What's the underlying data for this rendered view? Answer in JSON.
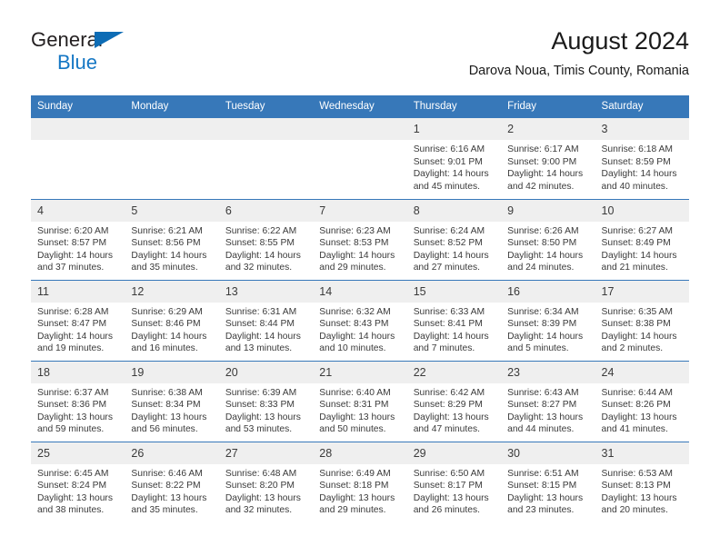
{
  "brand": {
    "name_top": "General",
    "name_bottom": "Blue",
    "triangle_color": "#0d6cb5",
    "text_color": "#231f20",
    "blue_color": "#1577c4"
  },
  "header": {
    "title": "August 2024",
    "subtitle": "Darova Noua, Timis County, Romania"
  },
  "theme": {
    "header_blue": "#3778b9",
    "daynum_band": "#efefef",
    "text": "#3a3a3a",
    "page_bg": "#ffffff"
  },
  "weekdays": [
    "Sunday",
    "Monday",
    "Tuesday",
    "Wednesday",
    "Thursday",
    "Friday",
    "Saturday"
  ],
  "calendar_data": {
    "month": "August",
    "year": 2024,
    "location": "Darova Noua, Timis County, Romania",
    "first_day_of_week": "Sunday",
    "weeks": [
      [
        {
          "day": "",
          "lines": []
        },
        {
          "day": "",
          "lines": []
        },
        {
          "day": "",
          "lines": []
        },
        {
          "day": "",
          "lines": []
        },
        {
          "day": "1",
          "lines": [
            "Sunrise: 6:16 AM",
            "Sunset: 9:01 PM",
            "Daylight: 14 hours and 45 minutes."
          ]
        },
        {
          "day": "2",
          "lines": [
            "Sunrise: 6:17 AM",
            "Sunset: 9:00 PM",
            "Daylight: 14 hours and 42 minutes."
          ]
        },
        {
          "day": "3",
          "lines": [
            "Sunrise: 6:18 AM",
            "Sunset: 8:59 PM",
            "Daylight: 14 hours and 40 minutes."
          ]
        }
      ],
      [
        {
          "day": "4",
          "lines": [
            "Sunrise: 6:20 AM",
            "Sunset: 8:57 PM",
            "Daylight: 14 hours and 37 minutes."
          ]
        },
        {
          "day": "5",
          "lines": [
            "Sunrise: 6:21 AM",
            "Sunset: 8:56 PM",
            "Daylight: 14 hours and 35 minutes."
          ]
        },
        {
          "day": "6",
          "lines": [
            "Sunrise: 6:22 AM",
            "Sunset: 8:55 PM",
            "Daylight: 14 hours and 32 minutes."
          ]
        },
        {
          "day": "7",
          "lines": [
            "Sunrise: 6:23 AM",
            "Sunset: 8:53 PM",
            "Daylight: 14 hours and 29 minutes."
          ]
        },
        {
          "day": "8",
          "lines": [
            "Sunrise: 6:24 AM",
            "Sunset: 8:52 PM",
            "Daylight: 14 hours and 27 minutes."
          ]
        },
        {
          "day": "9",
          "lines": [
            "Sunrise: 6:26 AM",
            "Sunset: 8:50 PM",
            "Daylight: 14 hours and 24 minutes."
          ]
        },
        {
          "day": "10",
          "lines": [
            "Sunrise: 6:27 AM",
            "Sunset: 8:49 PM",
            "Daylight: 14 hours and 21 minutes."
          ]
        }
      ],
      [
        {
          "day": "11",
          "lines": [
            "Sunrise: 6:28 AM",
            "Sunset: 8:47 PM",
            "Daylight: 14 hours and 19 minutes."
          ]
        },
        {
          "day": "12",
          "lines": [
            "Sunrise: 6:29 AM",
            "Sunset: 8:46 PM",
            "Daylight: 14 hours and 16 minutes."
          ]
        },
        {
          "day": "13",
          "lines": [
            "Sunrise: 6:31 AM",
            "Sunset: 8:44 PM",
            "Daylight: 14 hours and 13 minutes."
          ]
        },
        {
          "day": "14",
          "lines": [
            "Sunrise: 6:32 AM",
            "Sunset: 8:43 PM",
            "Daylight: 14 hours and 10 minutes."
          ]
        },
        {
          "day": "15",
          "lines": [
            "Sunrise: 6:33 AM",
            "Sunset: 8:41 PM",
            "Daylight: 14 hours and 7 minutes."
          ]
        },
        {
          "day": "16",
          "lines": [
            "Sunrise: 6:34 AM",
            "Sunset: 8:39 PM",
            "Daylight: 14 hours and 5 minutes."
          ]
        },
        {
          "day": "17",
          "lines": [
            "Sunrise: 6:35 AM",
            "Sunset: 8:38 PM",
            "Daylight: 14 hours and 2 minutes."
          ]
        }
      ],
      [
        {
          "day": "18",
          "lines": [
            "Sunrise: 6:37 AM",
            "Sunset: 8:36 PM",
            "Daylight: 13 hours and 59 minutes."
          ]
        },
        {
          "day": "19",
          "lines": [
            "Sunrise: 6:38 AM",
            "Sunset: 8:34 PM",
            "Daylight: 13 hours and 56 minutes."
          ]
        },
        {
          "day": "20",
          "lines": [
            "Sunrise: 6:39 AM",
            "Sunset: 8:33 PM",
            "Daylight: 13 hours and 53 minutes."
          ]
        },
        {
          "day": "21",
          "lines": [
            "Sunrise: 6:40 AM",
            "Sunset: 8:31 PM",
            "Daylight: 13 hours and 50 minutes."
          ]
        },
        {
          "day": "22",
          "lines": [
            "Sunrise: 6:42 AM",
            "Sunset: 8:29 PM",
            "Daylight: 13 hours and 47 minutes."
          ]
        },
        {
          "day": "23",
          "lines": [
            "Sunrise: 6:43 AM",
            "Sunset: 8:27 PM",
            "Daylight: 13 hours and 44 minutes."
          ]
        },
        {
          "day": "24",
          "lines": [
            "Sunrise: 6:44 AM",
            "Sunset: 8:26 PM",
            "Daylight: 13 hours and 41 minutes."
          ]
        }
      ],
      [
        {
          "day": "25",
          "lines": [
            "Sunrise: 6:45 AM",
            "Sunset: 8:24 PM",
            "Daylight: 13 hours and 38 minutes."
          ]
        },
        {
          "day": "26",
          "lines": [
            "Sunrise: 6:46 AM",
            "Sunset: 8:22 PM",
            "Daylight: 13 hours and 35 minutes."
          ]
        },
        {
          "day": "27",
          "lines": [
            "Sunrise: 6:48 AM",
            "Sunset: 8:20 PM",
            "Daylight: 13 hours and 32 minutes."
          ]
        },
        {
          "day": "28",
          "lines": [
            "Sunrise: 6:49 AM",
            "Sunset: 8:18 PM",
            "Daylight: 13 hours and 29 minutes."
          ]
        },
        {
          "day": "29",
          "lines": [
            "Sunrise: 6:50 AM",
            "Sunset: 8:17 PM",
            "Daylight: 13 hours and 26 minutes."
          ]
        },
        {
          "day": "30",
          "lines": [
            "Sunrise: 6:51 AM",
            "Sunset: 8:15 PM",
            "Daylight: 13 hours and 23 minutes."
          ]
        },
        {
          "day": "31",
          "lines": [
            "Sunrise: 6:53 AM",
            "Sunset: 8:13 PM",
            "Daylight: 13 hours and 20 minutes."
          ]
        }
      ]
    ]
  }
}
